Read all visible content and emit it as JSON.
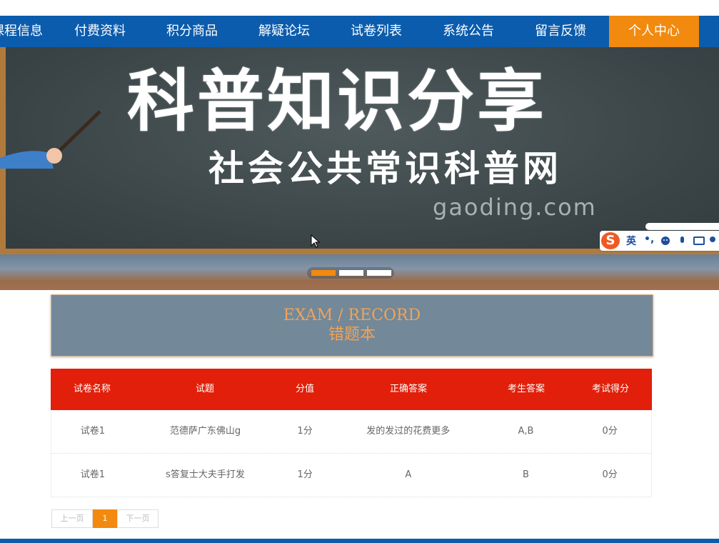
{
  "nav": {
    "items": [
      "课程信息",
      "付费资料",
      "积分商品",
      "解疑论坛",
      "试卷列表",
      "系统公告",
      "留言反馈",
      "个人中心"
    ],
    "active_index": 7
  },
  "banner": {
    "headline": "科普知识分享",
    "subline": "社会公共常识科普网",
    "watermark": "gaoding.com",
    "slide_count": 3,
    "active_slide": 0,
    "ime": {
      "lang": "英",
      "punct": "•,",
      "logo": "S"
    }
  },
  "panel": {
    "title_en": "EXAM / RECORD",
    "title_cn": "错题本"
  },
  "table": {
    "headers": [
      "试卷名称",
      "试题",
      "分值",
      "正确答案",
      "考生答案",
      "考试得分"
    ],
    "rows": [
      [
        "试卷1",
        "范德萨广东佛山g",
        "1分",
        "发的发过的花费更多",
        "A,B",
        "0分"
      ],
      [
        "试卷1",
        "s答复士大夫手打发",
        "1分",
        "A",
        "B",
        "0分"
      ]
    ]
  },
  "pager": {
    "prev": "上一页",
    "current": "1",
    "next": "下一页"
  },
  "colors": {
    "nav_bg": "#0b5cad",
    "accent": "#f28a0f",
    "table_header": "#e21f0a",
    "panel_bg": "#738898"
  }
}
